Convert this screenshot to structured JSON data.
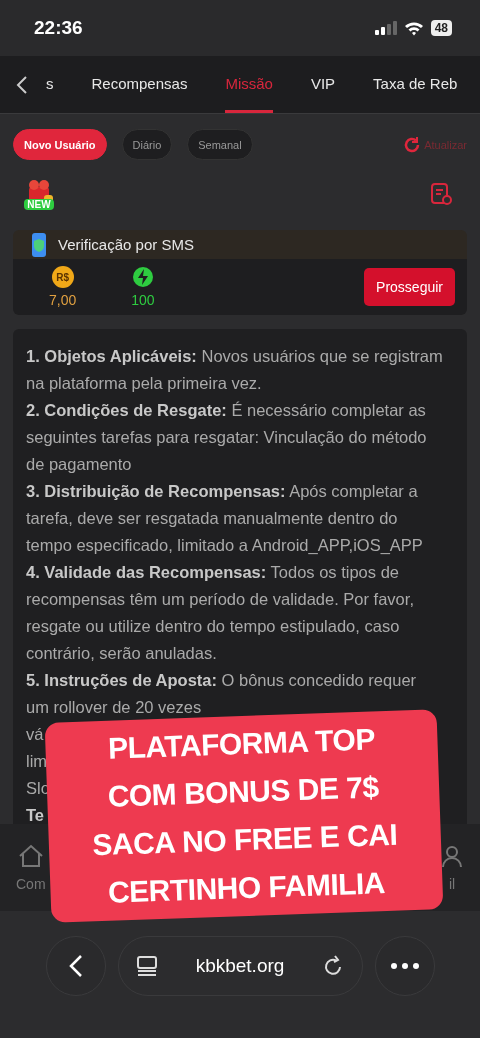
{
  "status_bar": {
    "time": "22:36",
    "battery": "48"
  },
  "tabs": [
    {
      "label": "s",
      "selected": false
    },
    {
      "label": "Recompensas",
      "selected": false
    },
    {
      "label": "Missão",
      "selected": true
    },
    {
      "label": "VIP",
      "selected": false
    },
    {
      "label": "Taxa de Reb",
      "selected": false
    }
  ],
  "filters": [
    {
      "label": "Novo Usuário",
      "selected": true
    },
    {
      "label": "Diário",
      "selected": false
    },
    {
      "label": "Semanal",
      "selected": false
    }
  ],
  "refresh": {
    "label": "Atualizar"
  },
  "badge": "NEW",
  "task": {
    "title": "Verificação por SMS",
    "reward_symbol": "R$",
    "reward": "7,00",
    "points": "100",
    "button": "Prosseguir"
  },
  "rules": [
    "**1. Objetos Aplicáveis:** Novos usuários que se registram na plataforma pela primeira vez.",
    "**2. Condições de Resgate:** É necessário completar as seguintes tarefas para resgatar: Vinculação do método de pagamento",
    "**3. Distribuição de Recompensas:** Após completar a tarefa, deve ser resgatada manualmente dentro do tempo especificado, limitado a Android_APP,iOS_APP",
    "**4. Validade das Recompensas:** Todos os tipos de recompensas têm um período de validade. Por favor, resgate ou utilize dentro do tempo estipulado, caso contrário, serão anuladas.",
    "**5. Instruções de Aposta:** O bônus concedido requer"
  ],
  "covered_lines": [
    "um rollover de 20 vezes",
    "vá",
    "lim",
    "Slo",
    "**Te**"
  ],
  "bottom_nav": [
    {
      "label": "Com",
      "kind": "home"
    },
    {
      "label": "il",
      "kind": "profile"
    }
  ],
  "caption_overlay": [
    "PLATAFORMA TOP",
    "COM BONUS DE 7$",
    "SACA NO FREE E CAI",
    "CERTINHO FAMILIA"
  ],
  "browser": {
    "url": "kbkbet.org"
  }
}
